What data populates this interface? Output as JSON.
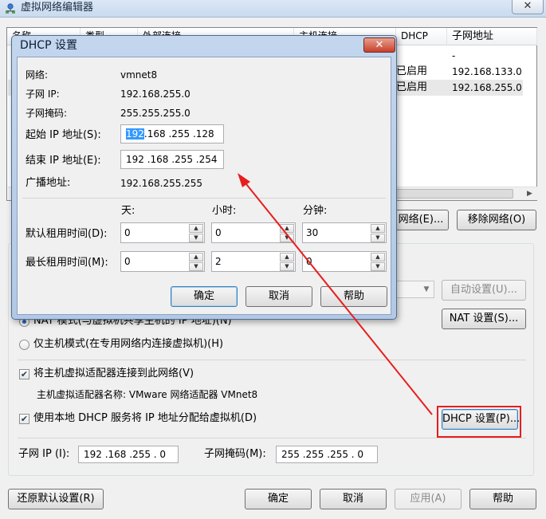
{
  "window": {
    "title": "虚拟网络编辑器",
    "close": "✕"
  },
  "table": {
    "headers": [
      "名称",
      "类型",
      "外部连接",
      "主机连接",
      "DHCP",
      "子网地址"
    ],
    "rows": [
      {
        "dhcp": "",
        "subnet": "-"
      },
      {
        "dhcp": "已启用",
        "subnet": "192.168.133.0"
      },
      {
        "dhcp": "已启用",
        "subnet": "192.168.255.0"
      }
    ]
  },
  "net_buttons": {
    "add": "网络(E)...",
    "remove": "移除网络(O)"
  },
  "vmnet": {
    "auto_settings": "自动设置(U)...",
    "nat_mode": "NAT 模式(与虚拟机共享主机的 IP 地址)(N)",
    "nat_settings": "NAT 设置(S)...",
    "host_only_mode": "仅主机模式(在专用网络内连接虚拟机)(H)",
    "connect_adapter": "将主机虚拟适配器连接到此网络(V)",
    "adapter_name_label": "主机虚拟适配器名称: VMware 网络适配器 VMnet8",
    "use_dhcp": "使用本地 DHCP 服务将 IP 地址分配给虚拟机(D)",
    "dhcp_settings": "DHCP 设置(P)...",
    "subnet_ip_label": "子网 IP (I):",
    "subnet_ip_value": "192 .168 .255 . 0",
    "subnet_mask_label": "子网掩码(M):",
    "subnet_mask_value": "255 .255 .255 . 0"
  },
  "footer": {
    "restore": "还原默认设置(R)",
    "ok": "确定",
    "cancel": "取消",
    "apply": "应用(A)",
    "help": "帮助"
  },
  "dhcp_dialog": {
    "title": "DHCP 设置",
    "network_label": "网络:",
    "network_value": "vmnet8",
    "subnet_ip_label": "子网 IP:",
    "subnet_ip_value": "192.168.255.0",
    "subnet_mask_label": "子网掩码:",
    "subnet_mask_value": "255.255.255.0",
    "start_ip_label": "起始 IP 地址(S):",
    "start_ip_first": "192",
    "start_ip_rest": ".168 .255 .128",
    "end_ip_label": "结束 IP 地址(E):",
    "end_ip_value": "192 .168 .255 .254",
    "broadcast_label": "广播地址:",
    "broadcast_value": "192.168.255.255",
    "col_days": "天:",
    "col_hours": "小时:",
    "col_minutes": "分钟:",
    "default_lease_label": "默认租用时间(D):",
    "default_lease": {
      "days": "0",
      "hours": "0",
      "minutes": "30"
    },
    "max_lease_label": "最长租用时间(M):",
    "max_lease": {
      "days": "0",
      "hours": "2",
      "minutes": "0"
    },
    "ok": "确定",
    "cancel": "取消",
    "help": "帮助"
  },
  "colors": {
    "annotation": "#e81d1d",
    "selection": "#3399ff"
  },
  "icons": [
    "network-app-icon",
    "close-icon",
    "spin-up-icon",
    "spin-down-icon",
    "checkbox-checked-icon",
    "arrow-annotation"
  ]
}
